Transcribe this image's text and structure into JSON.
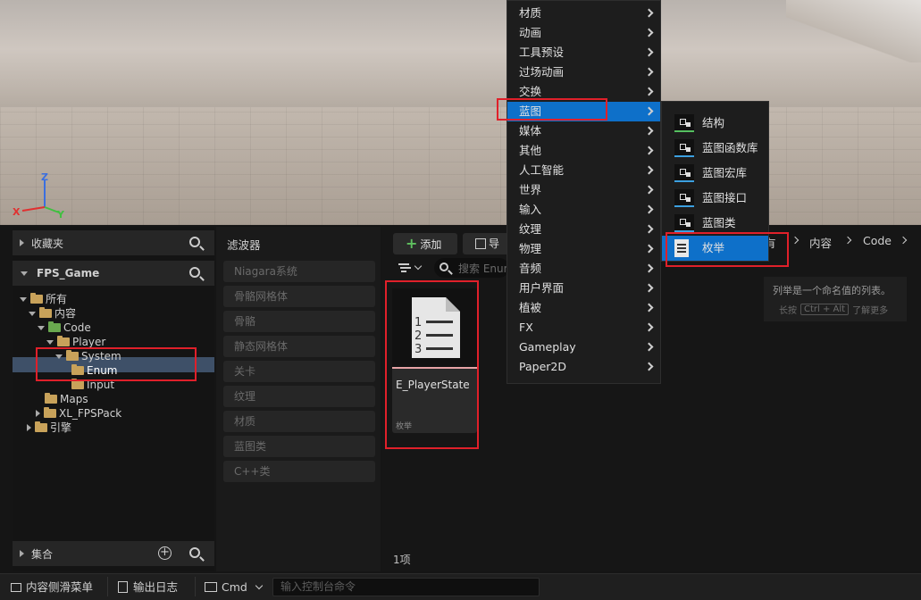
{
  "viewport": {
    "axes": {
      "z": "Z",
      "x": "X",
      "y": "Y"
    }
  },
  "left_panel": {
    "favorites_label": "收藏夹",
    "project_label": "FPS_Game",
    "collections_label": "集合",
    "tree": [
      {
        "label": "所有"
      },
      {
        "label": "内容"
      },
      {
        "label": "Code"
      },
      {
        "label": "Player"
      },
      {
        "label": "System"
      },
      {
        "label": "Enum"
      },
      {
        "label": "Input"
      },
      {
        "label": "Maps"
      },
      {
        "label": "XL_FPSPack"
      },
      {
        "label": "引擎"
      }
    ]
  },
  "filters": {
    "title": "滤波器",
    "items": [
      "Niagara系统",
      "骨骼网格体",
      "骨骼",
      "静态网格体",
      "关卡",
      "纹理",
      "材质",
      "蓝图类",
      "C++类"
    ]
  },
  "content": {
    "add_label": "添加",
    "import_label": "导入",
    "search_placeholder": "搜索 Enum",
    "breadcrumb": [
      "有",
      "内容",
      "Code"
    ],
    "asset": {
      "name": "E_PlayerState",
      "type": "枚举",
      "icon_digits": [
        "1",
        "2",
        "3"
      ]
    },
    "item_count": "1项",
    "tooltip": {
      "text": "列举是一个命名值的列表。",
      "hint_prefix": "长按",
      "hint_key": "Ctrl + Alt",
      "hint_suffix": "了解更多"
    }
  },
  "context_menu": {
    "items": [
      "材质",
      "动画",
      "工具预设",
      "过场动画",
      "交换",
      "蓝图",
      "媒体",
      "其他",
      "人工智能",
      "世界",
      "输入",
      "纹理",
      "物理",
      "音频",
      "用户界面",
      "植被",
      "FX",
      "Gameplay",
      "Paper2D"
    ]
  },
  "submenu": {
    "items": [
      "结构",
      "蓝图函数库",
      "蓝图宏库",
      "蓝图接口",
      "蓝图类",
      "枚举"
    ]
  },
  "bottom_bar": {
    "drawer_label": "内容侧滑菜单",
    "log_label": "输出日志",
    "cmd_label": "Cmd",
    "console_placeholder": "输入控制台命令"
  },
  "colors": {
    "accent": "#0e70c9",
    "highlight": "#e0202a",
    "folder": "#c8a25a",
    "folder_code": "#6aa84f"
  }
}
